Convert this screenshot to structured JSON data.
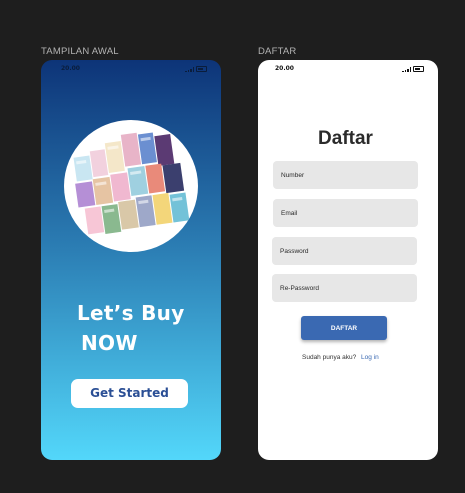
{
  "frames": {
    "left_label": "TAMPILAN AWAL",
    "right_label": "DAFTAR"
  },
  "status_bar": {
    "time": "20.00"
  },
  "welcome": {
    "line1": "Let’s Buy",
    "line2": "NOW",
    "button": "Get Started"
  },
  "register": {
    "title": "Daftar",
    "fields": {
      "number": "Number",
      "email": "Email",
      "password": "Password",
      "repassword": "Re-Password"
    },
    "submit": "DAFTAR",
    "login_prompt": "Sudah punya aku?",
    "login_link": "Log in"
  },
  "colors": {
    "gradient_top": "#0d3478",
    "gradient_bottom": "#53d7fa",
    "accent": "#3a69b2",
    "field_bg": "#e7e7e7"
  },
  "icons": [
    "signal-icon",
    "battery-icon",
    "books-illustration"
  ]
}
